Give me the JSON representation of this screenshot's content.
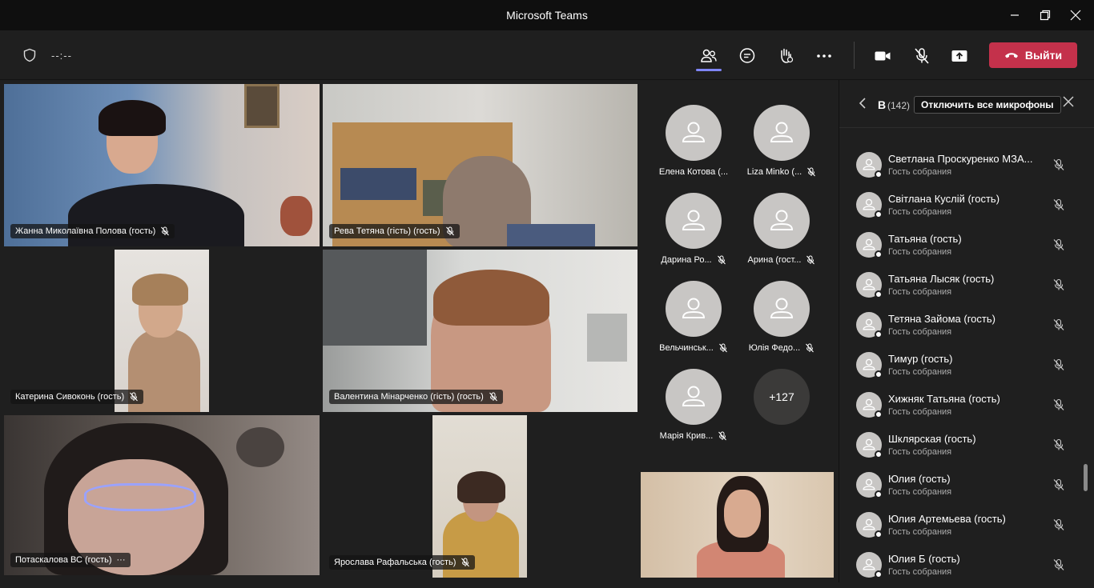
{
  "window": {
    "title": "Microsoft Teams",
    "controls": [
      "minimize-icon",
      "maximize-icon",
      "close-icon"
    ]
  },
  "toolbar": {
    "timer": "--:--",
    "icons": [
      "participants-icon",
      "chat-icon",
      "raise-hand-icon",
      "more-icon",
      "camera-icon",
      "mic-off-icon",
      "share-icon"
    ],
    "leave_label": "Выйти",
    "leave_color": "#c4314b",
    "accent": "#7f85f5"
  },
  "stage": {
    "videos": [
      {
        "name": "Жанна Миколаївна Полова (гость)"
      },
      {
        "name": "Рева Тетяна (гість) (гость)"
      },
      {
        "name": "Катерина Сивоконь (гость)"
      },
      {
        "name": "Валентина Мінарченко (гість) (гость)"
      },
      {
        "name": "Потаскалова ВС (гость)",
        "more": "···"
      },
      {
        "name": "Ярослава Рафальська (гость)"
      }
    ],
    "avatars": [
      {
        "name": "Елена Котова (..."
      },
      {
        "name": "Liza Minko (..."
      },
      {
        "name": "Дарина Ро..."
      },
      {
        "name": "Арина (гост..."
      },
      {
        "name": "Вельчинськ..."
      },
      {
        "name": "Юлія Федо..."
      },
      {
        "name": "Марія Крив..."
      }
    ],
    "more_count": "+127"
  },
  "panel": {
    "title": "В",
    "count": "(142)",
    "mute_all_label": "Отключить все микрофоны",
    "participants": [
      {
        "name": "Светлана Проскуренко МЗА...",
        "role": "Гость собрания"
      },
      {
        "name": "Світлана Куслій (гость)",
        "role": "Гость собрания"
      },
      {
        "name": "Татьяна (гость)",
        "role": "Гость собрания"
      },
      {
        "name": "Татьяна Лысяк (гость)",
        "role": "Гость собрания"
      },
      {
        "name": "Тетяна Зайома (гость)",
        "role": "Гость собрания"
      },
      {
        "name": "Тимур (гость)",
        "role": "Гость собрания"
      },
      {
        "name": "Хижняк Татьяна (гость)",
        "role": "Гость собрания"
      },
      {
        "name": "Шклярская (гость)",
        "role": "Гость собрания"
      },
      {
        "name": "Юлия (гость)",
        "role": "Гость собрания"
      },
      {
        "name": "Юлия Артемьева (гость)",
        "role": "Гость собрания"
      },
      {
        "name": "Юлия Б (гость)",
        "role": "Гость собрания"
      }
    ]
  }
}
